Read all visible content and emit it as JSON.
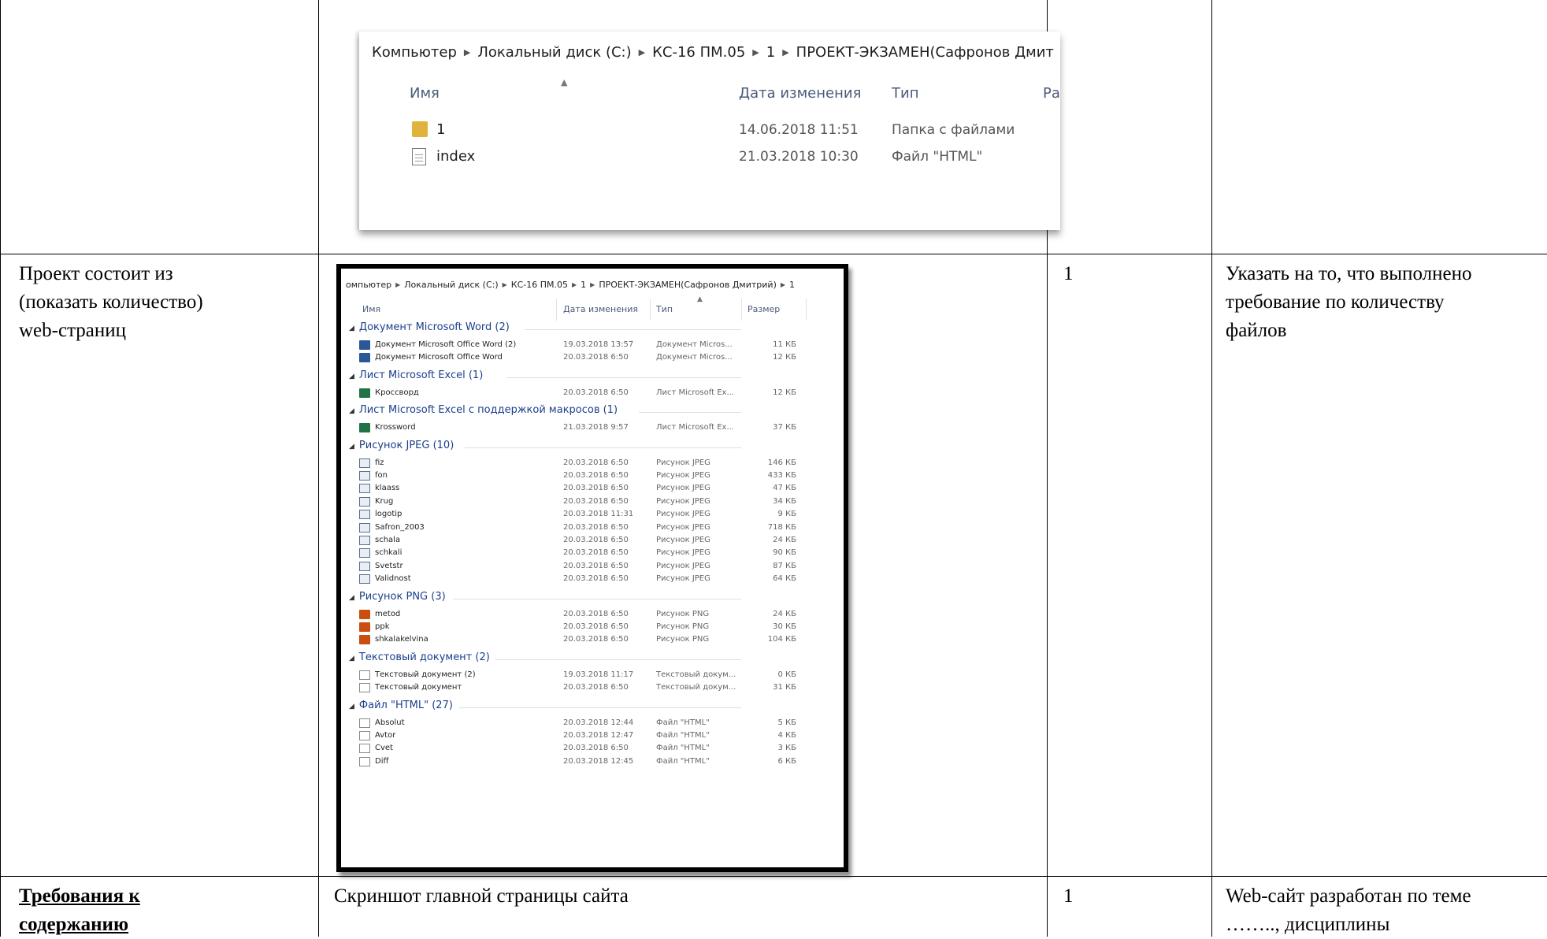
{
  "table": {
    "row2": {
      "col1": [
        "Проект состоит из",
        "(показать количество)",
        "web-страниц"
      ],
      "col3": "1",
      "col4": [
        "Указать на то, что выполнено",
        "требование по количеству",
        "файлов"
      ]
    },
    "row3": {
      "col1": [
        "Требования к",
        "содержанию"
      ],
      "col2": "Скриншот главной страницы сайта",
      "col3": "1",
      "col4": [
        "Web-сайт разработан по теме",
        "…….., дисциплины"
      ]
    }
  },
  "explorer1": {
    "breadcrumbs": [
      "Компьютер",
      "Локальный диск (C:)",
      "КС-16 ПМ.05",
      "1",
      "ПРОЕКТ-ЭКЗАМЕН(Сафронов Дмит"
    ],
    "columns": {
      "name": "Имя",
      "date": "Дата изменения",
      "type": "Тип",
      "size": "Ра"
    },
    "rows": [
      {
        "name": "1",
        "date": "14.06.2018 11:51",
        "type": "Папка с файлами"
      },
      {
        "name": "index",
        "date": "21.03.2018 10:30",
        "type": "Файл \"HTML\""
      }
    ]
  },
  "explorer2": {
    "breadcrumbs": [
      "омпьютер",
      "Локальный диск (C:)",
      "КС-16 ПМ.05",
      "1",
      "ПРОЕКТ-ЭКЗАМЕН(Сафронов Дмитрий)",
      "1"
    ],
    "columns": {
      "name": "Имя",
      "date": "Дата изменения",
      "type": "Тип",
      "size": "Размер"
    },
    "groups": [
      {
        "label": "Документ Microsoft Word (2)",
        "icon": "word-icon",
        "files": [
          {
            "name": "Документ Microsoft Office Word (2)",
            "date": "19.03.2018 13:57",
            "type": "Документ Micros...",
            "size": "11 КБ"
          },
          {
            "name": "Документ Microsoft Office Word",
            "date": "20.03.2018 6:50",
            "type": "Документ Micros...",
            "size": "12 КБ"
          }
        ]
      },
      {
        "label": "Лист Microsoft Excel (1)",
        "icon": "excel-icon",
        "files": [
          {
            "name": "Кроссворд",
            "date": "20.03.2018 6:50",
            "type": "Лист Microsoft Ex...",
            "size": "12 КБ"
          }
        ]
      },
      {
        "label": "Лист Microsoft Excel с поддержкой макросов (1)",
        "icon": "excel-icon",
        "files": [
          {
            "name": "Krossword",
            "date": "21.03.2018 9:57",
            "type": "Лист Microsoft Ex...",
            "size": "37 КБ"
          }
        ]
      },
      {
        "label": "Рисунок JPEG (10)",
        "icon": "jpeg-icon",
        "files": [
          {
            "name": "fiz",
            "date": "20.03.2018 6:50",
            "type": "Рисунок JPEG",
            "size": "146 КБ"
          },
          {
            "name": "fon",
            "date": "20.03.2018 6:50",
            "type": "Рисунок JPEG",
            "size": "433 КБ"
          },
          {
            "name": "klaass",
            "date": "20.03.2018 6:50",
            "type": "Рисунок JPEG",
            "size": "47 КБ"
          },
          {
            "name": "Krug",
            "date": "20.03.2018 6:50",
            "type": "Рисунок JPEG",
            "size": "34 КБ"
          },
          {
            "name": "logotip",
            "date": "20.03.2018 11:31",
            "type": "Рисунок JPEG",
            "size": "9 КБ"
          },
          {
            "name": "Safron_2003",
            "date": "20.03.2018 6:50",
            "type": "Рисунок JPEG",
            "size": "718 КБ"
          },
          {
            "name": "schala",
            "date": "20.03.2018 6:50",
            "type": "Рисунок JPEG",
            "size": "24 КБ"
          },
          {
            "name": "schkali",
            "date": "20.03.2018 6:50",
            "type": "Рисунок JPEG",
            "size": "90 КБ"
          },
          {
            "name": "Svetstr",
            "date": "20.03.2018 6:50",
            "type": "Рисунок JPEG",
            "size": "87 КБ"
          },
          {
            "name": "Validnost",
            "date": "20.03.2018 6:50",
            "type": "Рисунок JPEG",
            "size": "64 КБ"
          }
        ]
      },
      {
        "label": "Рисунок PNG (3)",
        "icon": "png-icon",
        "files": [
          {
            "name": "metod",
            "date": "20.03.2018 6:50",
            "type": "Рисунок PNG",
            "size": "24 КБ"
          },
          {
            "name": "ppk",
            "date": "20.03.2018 6:50",
            "type": "Рисунок PNG",
            "size": "30 КБ"
          },
          {
            "name": "shkalakelvina",
            "date": "20.03.2018 6:50",
            "type": "Рисунок PNG",
            "size": "104 КБ"
          }
        ]
      },
      {
        "label": "Текстовый документ (2)",
        "icon": "text-icon",
        "files": [
          {
            "name": "Текстовый документ (2)",
            "date": "19.03.2018 11:17",
            "type": "Текстовый докум...",
            "size": "0 КБ"
          },
          {
            "name": "Текстовый документ",
            "date": "20.03.2018 6:50",
            "type": "Текстовый докум...",
            "size": "31 КБ"
          }
        ]
      },
      {
        "label": "Файл \"HTML\" (27)",
        "icon": "html-icon",
        "files": [
          {
            "name": "Absolut",
            "date": "20.03.2018 12:44",
            "type": "Файл \"HTML\"",
            "size": "5 КБ"
          },
          {
            "name": "Avtor",
            "date": "20.03.2018 12:47",
            "type": "Файл \"HTML\"",
            "size": "4 КБ"
          },
          {
            "name": "Cvet",
            "date": "20.03.2018 6:50",
            "type": "Файл \"HTML\"",
            "size": "3 КБ"
          },
          {
            "name": "Diff",
            "date": "20.03.2018 12:45",
            "type": "Файл \"HTML\"",
            "size": "6 КБ"
          }
        ]
      }
    ]
  }
}
